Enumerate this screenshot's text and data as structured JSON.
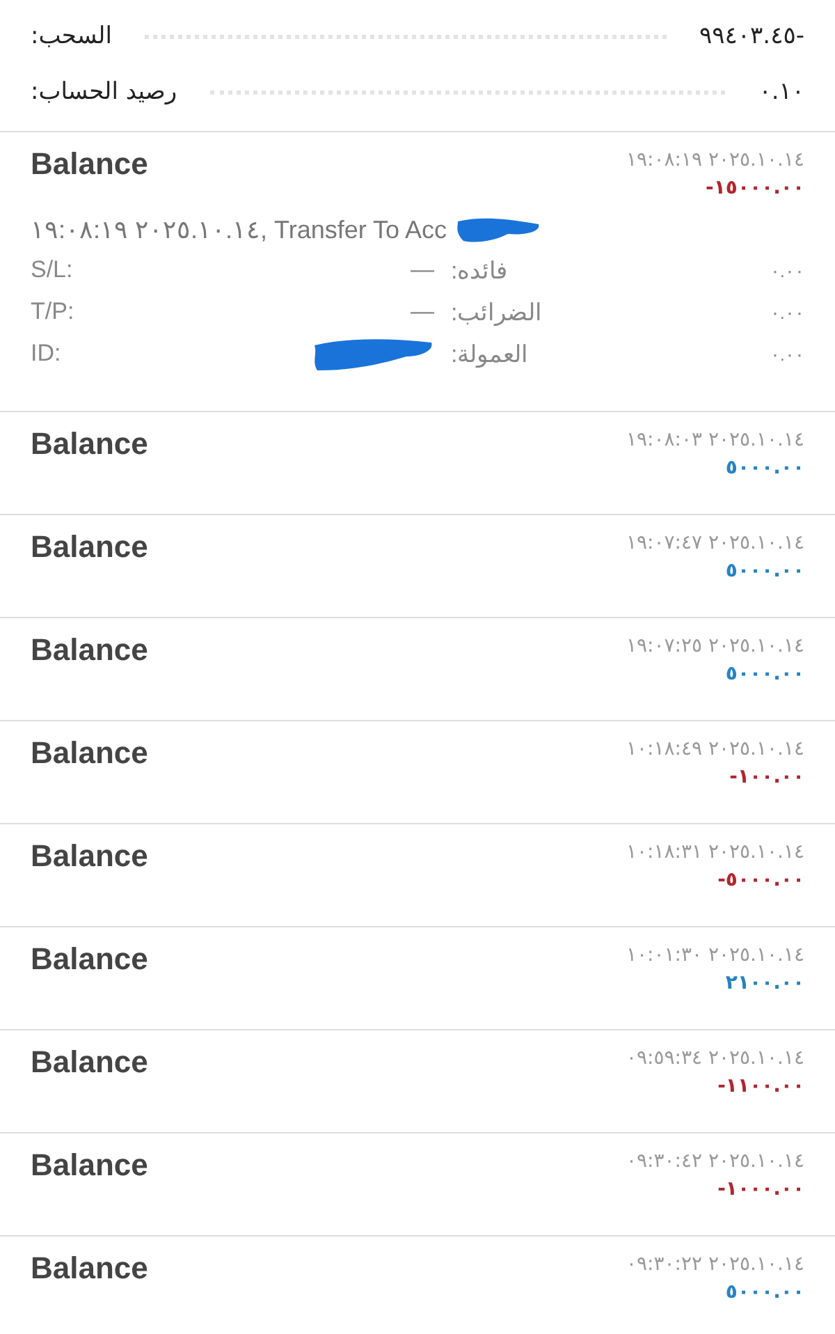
{
  "summary": [
    {
      "label": "السحب:",
      "value": "-٩٩٤٠٣.٤٥"
    },
    {
      "label": "رصيد الحساب:",
      "value": "٠.١٠"
    }
  ],
  "entries": [
    {
      "title": "Balance",
      "time": "١٩:٠٨:١٩ ٢٠٢٥.١٠.١٤",
      "amount": "-١٥٠٠٠.٠٠",
      "kind": "debit",
      "expanded": true,
      "comment": "١٩:٠٨:١٩ ٢٠٢٥.١٠.١٤, Transfer To Acc",
      "details": [
        {
          "left_label": "S/L:",
          "left_value": "—",
          "right_label": "فائده:",
          "right_value": "٠.٠٠"
        },
        {
          "left_label": "T/P:",
          "left_value": "—",
          "right_label": "الضرائب:",
          "right_value": "٠.٠٠"
        },
        {
          "left_label": "ID:",
          "right_label": "العمولة:",
          "right_value": "٠.٠٠"
        }
      ]
    },
    {
      "title": "Balance",
      "time": "١٩:٠٨:٠٣ ٢٠٢٥.١٠.١٤",
      "amount": "٥٠٠٠.٠٠",
      "kind": "credit",
      "expanded": false
    },
    {
      "title": "Balance",
      "time": "١٩:٠٧:٤٧ ٢٠٢٥.١٠.١٤",
      "amount": "٥٠٠٠.٠٠",
      "kind": "credit",
      "expanded": false
    },
    {
      "title": "Balance",
      "time": "١٩:٠٧:٢٥ ٢٠٢٥.١٠.١٤",
      "amount": "٥٠٠٠.٠٠",
      "kind": "credit",
      "expanded": false
    },
    {
      "title": "Balance",
      "time": "١٠:١٨:٤٩ ٢٠٢٥.١٠.١٤",
      "amount": "-١٠٠.٠٠",
      "kind": "debit",
      "expanded": false
    },
    {
      "title": "Balance",
      "time": "١٠:١٨:٣١ ٢٠٢٥.١٠.١٤",
      "amount": "-٥٠٠٠.٠٠",
      "kind": "debit",
      "expanded": false
    },
    {
      "title": "Balance",
      "time": "١٠:٠١:٣٠ ٢٠٢٥.١٠.١٤",
      "amount": "٢١٠٠.٠٠",
      "kind": "credit",
      "expanded": false
    },
    {
      "title": "Balance",
      "time": "٠٩:٥٩:٣٤ ٢٠٢٥.١٠.١٤",
      "amount": "-١١٠٠.٠٠",
      "kind": "debit",
      "expanded": false
    },
    {
      "title": "Balance",
      "time": "٠٩:٣٠:٤٢ ٢٠٢٥.١٠.١٤",
      "amount": "-١٠٠٠.٠٠",
      "kind": "debit",
      "expanded": false
    },
    {
      "title": "Balance",
      "time": "٠٩:٣٠:٢٢ ٢٠٢٥.١٠.١٤",
      "amount": "٥٠٠٠.٠٠",
      "kind": "credit",
      "expanded": false
    }
  ]
}
